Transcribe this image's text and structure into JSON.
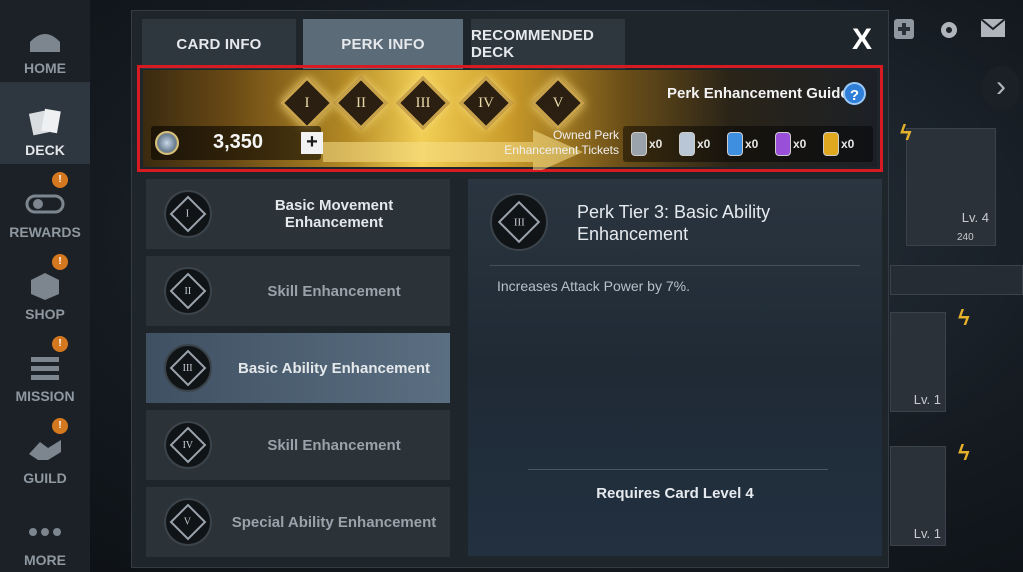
{
  "nav": {
    "items": [
      {
        "label": "HOME",
        "icon": "home-icon"
      },
      {
        "label": "DECK",
        "icon": "deck-icon",
        "active": true
      },
      {
        "label": "REWARDS",
        "icon": "rewards-icon",
        "badge": "!"
      },
      {
        "label": "SHOP",
        "icon": "shop-icon",
        "badge": "!"
      },
      {
        "label": "MISSION",
        "icon": "mission-icon",
        "badge": "!"
      },
      {
        "label": "GUILD",
        "icon": "guild-icon",
        "badge": "!"
      },
      {
        "label": "MORE",
        "icon": "more-icon"
      }
    ]
  },
  "background": {
    "card_levels": [
      "Lv. 4",
      "Lv. 1",
      "Lv. 1"
    ],
    "card_partial": "240"
  },
  "tabs": [
    {
      "label": "CARD INFO"
    },
    {
      "label": "PERK INFO",
      "active": true
    },
    {
      "label": "RECOMMENDED DECK"
    }
  ],
  "close_label": "X",
  "banner": {
    "tiers": [
      "I",
      "II",
      "III",
      "IV",
      "V"
    ],
    "guide_label": "Perk Enhancement Guide",
    "help_label": "?",
    "owned_label_line1": "Owned Perk",
    "owned_label_line2": "Enhancement Tickets",
    "tickets": [
      {
        "count": "x0",
        "color": "#9aa3ab"
      },
      {
        "count": "x0",
        "color": "#b8c6d6"
      },
      {
        "count": "x0",
        "color": "#3f8fe0"
      },
      {
        "count": "x0",
        "color": "#9a4fd8"
      },
      {
        "count": "x0",
        "color": "#e0a820"
      }
    ],
    "currency_amount": "3,350",
    "plus_label": "+"
  },
  "perks": [
    {
      "tier": "I",
      "label": "Basic Movement Enhancement"
    },
    {
      "tier": "II",
      "label": "Skill Enhancement"
    },
    {
      "tier": "III",
      "label": "Basic Ability Enhancement",
      "selected": true
    },
    {
      "tier": "IV",
      "label": "Skill Enhancement"
    },
    {
      "tier": "V",
      "label": "Special Ability Enhancement"
    }
  ],
  "detail": {
    "tier": "III",
    "title": "Perk Tier 3: Basic Ability Enhancement",
    "description": "Increases Attack Power by 7%.",
    "requirement": "Requires Card Level 4"
  },
  "colors": {
    "accent_red": "#d81b22",
    "gold": "#c9a24a",
    "active_tab": "#5c6b78"
  }
}
